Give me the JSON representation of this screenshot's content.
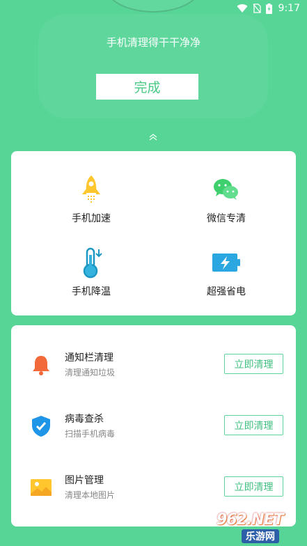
{
  "status_bar": {
    "time": "9:17",
    "icons": [
      "wifi-icon",
      "no-sim-icon",
      "battery-charging-icon"
    ]
  },
  "header": {
    "headline": "手机清理得干干净净",
    "done_button": "完成",
    "collapse_icon": "double-chevron-up-icon"
  },
  "features": [
    {
      "label": "手机加速",
      "icon": "rocket-icon"
    },
    {
      "label": "微信专清",
      "icon": "wechat-icon"
    },
    {
      "label": "手机降温",
      "icon": "thermometer-icon"
    },
    {
      "label": "超强省电",
      "icon": "battery-bolt-icon"
    }
  ],
  "tasks": [
    {
      "title": "通知栏清理",
      "subtitle": "清理通知垃圾",
      "button": "立即清理",
      "icon": "bell-icon"
    },
    {
      "title": "病毒查杀",
      "subtitle": "扫描手机病毒",
      "button": "立即清理",
      "icon": "shield-check-icon"
    },
    {
      "title": "图片管理",
      "subtitle": "清理本地图片",
      "button": "立即清理",
      "icon": "image-icon"
    }
  ],
  "watermark": {
    "top": "962.NET",
    "bottom": "乐游网"
  },
  "colors": {
    "background": "#56d596",
    "accent": "#48c987",
    "button_border": "#5fd39c"
  }
}
